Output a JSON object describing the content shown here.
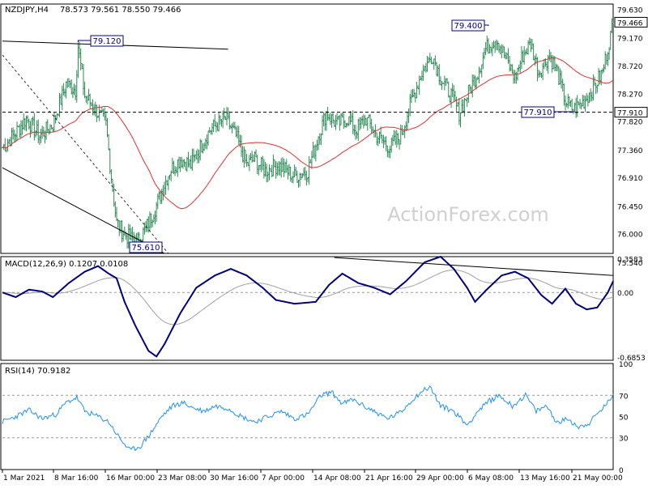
{
  "header": {
    "symbol": "NZDJPY,H4",
    "ohlc": "78.573 79.561 78.550 79.466"
  },
  "watermark": "ActionForex.com",
  "colors": {
    "bars": "#2e8b57",
    "ma": "#e03030",
    "macd_main": "#000080",
    "macd_signal": "#a0a0a0",
    "rsi": "#1e90ff",
    "trendline": "#000000",
    "frame": "#000000",
    "box": "#00008b"
  },
  "chart_data": [
    {
      "type": "bar",
      "panel": "price",
      "title": "NZDJPY,H4",
      "ylim": [
        75.47,
        79.78
      ],
      "y_ticks": [
        "79.630",
        "79.170",
        "78.720",
        "78.270",
        "77.820",
        "77.360",
        "76.910",
        "76.450",
        "76.000",
        "75.540"
      ],
      "last_price": "79.466",
      "support_level": "77.910",
      "x_ticks": [
        "1 Mar 2021",
        "8 Mar 16:00",
        "16 Mar 00:00",
        "23 Mar 08:00",
        "30 Mar 16:00",
        "7 Apr 00:00",
        "14 Apr 08:00",
        "21 Apr 16:00",
        "29 Apr 00:00",
        "6 May 08:00",
        "13 May 16:00",
        "21 May 00:00"
      ],
      "annotations": [
        {
          "label": "79.120",
          "value": 79.12,
          "bar": 57
        },
        {
          "label": "75.610",
          "value": 75.61,
          "bar": 101
        },
        {
          "label": "79.400",
          "value": 79.4,
          "bar": 366
        },
        {
          "label": "77.910",
          "value": 77.91,
          "bar": 430
        }
      ],
      "closes_anchor_points": [
        [
          0,
          77.3
        ],
        [
          8,
          77.5
        ],
        [
          18,
          77.8
        ],
        [
          28,
          77.5
        ],
        [
          38,
          77.7
        ],
        [
          48,
          78.4
        ],
        [
          55,
          78.3
        ],
        [
          57,
          79.05
        ],
        [
          62,
          78.2
        ],
        [
          72,
          77.9
        ],
        [
          78,
          77.7
        ],
        [
          82,
          76.8
        ],
        [
          86,
          76.0
        ],
        [
          92,
          75.8
        ],
        [
          101,
          75.65
        ],
        [
          108,
          75.9
        ],
        [
          116,
          76.3
        ],
        [
          126,
          76.9
        ],
        [
          134,
          77.1
        ],
        [
          142,
          77.0
        ],
        [
          156,
          77.6
        ],
        [
          168,
          77.8
        ],
        [
          176,
          77.5
        ],
        [
          184,
          77.0
        ],
        [
          190,
          77.1
        ],
        [
          198,
          76.9
        ],
        [
          208,
          77.0
        ],
        [
          220,
          76.8
        ],
        [
          230,
          76.9
        ],
        [
          238,
          77.5
        ],
        [
          244,
          77.9
        ],
        [
          252,
          77.7
        ],
        [
          260,
          77.8
        ],
        [
          266,
          77.6
        ],
        [
          274,
          77.8
        ],
        [
          282,
          77.5
        ],
        [
          292,
          77.3
        ],
        [
          300,
          77.5
        ],
        [
          308,
          78.1
        ],
        [
          316,
          78.6
        ],
        [
          324,
          78.9
        ],
        [
          330,
          78.5
        ],
        [
          338,
          78.2
        ],
        [
          344,
          77.9
        ],
        [
          350,
          78.2
        ],
        [
          358,
          78.6
        ],
        [
          364,
          79.0
        ],
        [
          372,
          79.2
        ],
        [
          378,
          78.9
        ],
        [
          386,
          78.5
        ],
        [
          392,
          78.9
        ],
        [
          398,
          79.1
        ],
        [
          404,
          78.6
        ],
        [
          412,
          78.9
        ],
        [
          418,
          78.6
        ],
        [
          424,
          78.1
        ],
        [
          430,
          77.95
        ],
        [
          438,
          78.1
        ],
        [
          444,
          78.3
        ],
        [
          452,
          78.6
        ],
        [
          460,
          79.45
        ]
      ],
      "moving_average_period": 55
    },
    {
      "type": "line",
      "panel": "macd",
      "title": "MACD(12,26,9) 0.1207 0.0108",
      "ylim": [
        -0.72,
        0.38
      ],
      "y_ticks": [
        "0.3583",
        "0.00",
        "-0.6853"
      ],
      "series": [
        {
          "name": "MACD",
          "anchor_points": [
            [
              0,
              0.0
            ],
            [
              10,
              -0.05
            ],
            [
              20,
              0.03
            ],
            [
              30,
              0.01
            ],
            [
              38,
              -0.05
            ],
            [
              50,
              0.1
            ],
            [
              62,
              0.22
            ],
            [
              72,
              0.28
            ],
            [
              80,
              0.2
            ],
            [
              86,
              0.15
            ],
            [
              92,
              -0.1
            ],
            [
              100,
              -0.35
            ],
            [
              110,
              -0.62
            ],
            [
              116,
              -0.68
            ],
            [
              122,
              -0.55
            ],
            [
              134,
              -0.22
            ],
            [
              146,
              0.05
            ],
            [
              160,
              0.18
            ],
            [
              172,
              0.25
            ],
            [
              184,
              0.18
            ],
            [
              196,
              0.05
            ],
            [
              206,
              -0.08
            ],
            [
              220,
              -0.12
            ],
            [
              236,
              -0.1
            ],
            [
              246,
              0.08
            ],
            [
              256,
              0.2
            ],
            [
              268,
              0.1
            ],
            [
              280,
              0.05
            ],
            [
              292,
              -0.02
            ],
            [
              304,
              0.12
            ],
            [
              318,
              0.32
            ],
            [
              330,
              0.38
            ],
            [
              340,
              0.25
            ],
            [
              350,
              0.05
            ],
            [
              356,
              -0.1
            ],
            [
              364,
              0.02
            ],
            [
              376,
              0.18
            ],
            [
              386,
              0.22
            ],
            [
              396,
              0.15
            ],
            [
              406,
              -0.03
            ],
            [
              414,
              -0.12
            ],
            [
              424,
              0.04
            ],
            [
              432,
              -0.12
            ],
            [
              440,
              -0.18
            ],
            [
              448,
              -0.16
            ],
            [
              456,
              0.0
            ],
            [
              460,
              0.12
            ]
          ]
        }
      ]
    },
    {
      "type": "line",
      "panel": "rsi",
      "title": "RSI(14) 70.9182",
      "ylim": [
        0,
        100
      ],
      "y_ticks": [
        "100",
        "70",
        "50",
        "30",
        "0"
      ],
      "levels": [
        70,
        30
      ],
      "series": [
        {
          "name": "RSI",
          "anchor_points": [
            [
              0,
              45
            ],
            [
              10,
              50
            ],
            [
              20,
              56
            ],
            [
              30,
              48
            ],
            [
              40,
              52
            ],
            [
              48,
              63
            ],
            [
              56,
              68
            ],
            [
              62,
              55
            ],
            [
              72,
              50
            ],
            [
              80,
              45
            ],
            [
              88,
              30
            ],
            [
              96,
              18
            ],
            [
              104,
              22
            ],
            [
              112,
              35
            ],
            [
              120,
              50
            ],
            [
              128,
              60
            ],
            [
              136,
              63
            ],
            [
              144,
              58
            ],
            [
              152,
              55
            ],
            [
              160,
              60
            ],
            [
              170,
              58
            ],
            [
              180,
              50
            ],
            [
              190,
              45
            ],
            [
              200,
              50
            ],
            [
              210,
              55
            ],
            [
              220,
              48
            ],
            [
              230,
              52
            ],
            [
              240,
              70
            ],
            [
              248,
              73
            ],
            [
              256,
              62
            ],
            [
              264,
              66
            ],
            [
              272,
              60
            ],
            [
              280,
              55
            ],
            [
              290,
              48
            ],
            [
              300,
              54
            ],
            [
              308,
              65
            ],
            [
              316,
              74
            ],
            [
              322,
              78
            ],
            [
              330,
              60
            ],
            [
              340,
              55
            ],
            [
              350,
              42
            ],
            [
              358,
              55
            ],
            [
              366,
              64
            ],
            [
              374,
              70
            ],
            [
              384,
              60
            ],
            [
              394,
              70
            ],
            [
              402,
              55
            ],
            [
              410,
              60
            ],
            [
              418,
              44
            ],
            [
              426,
              48
            ],
            [
              434,
              40
            ],
            [
              442,
              44
            ],
            [
              450,
              55
            ],
            [
              456,
              63
            ],
            [
              460,
              71
            ]
          ]
        }
      ]
    }
  ]
}
